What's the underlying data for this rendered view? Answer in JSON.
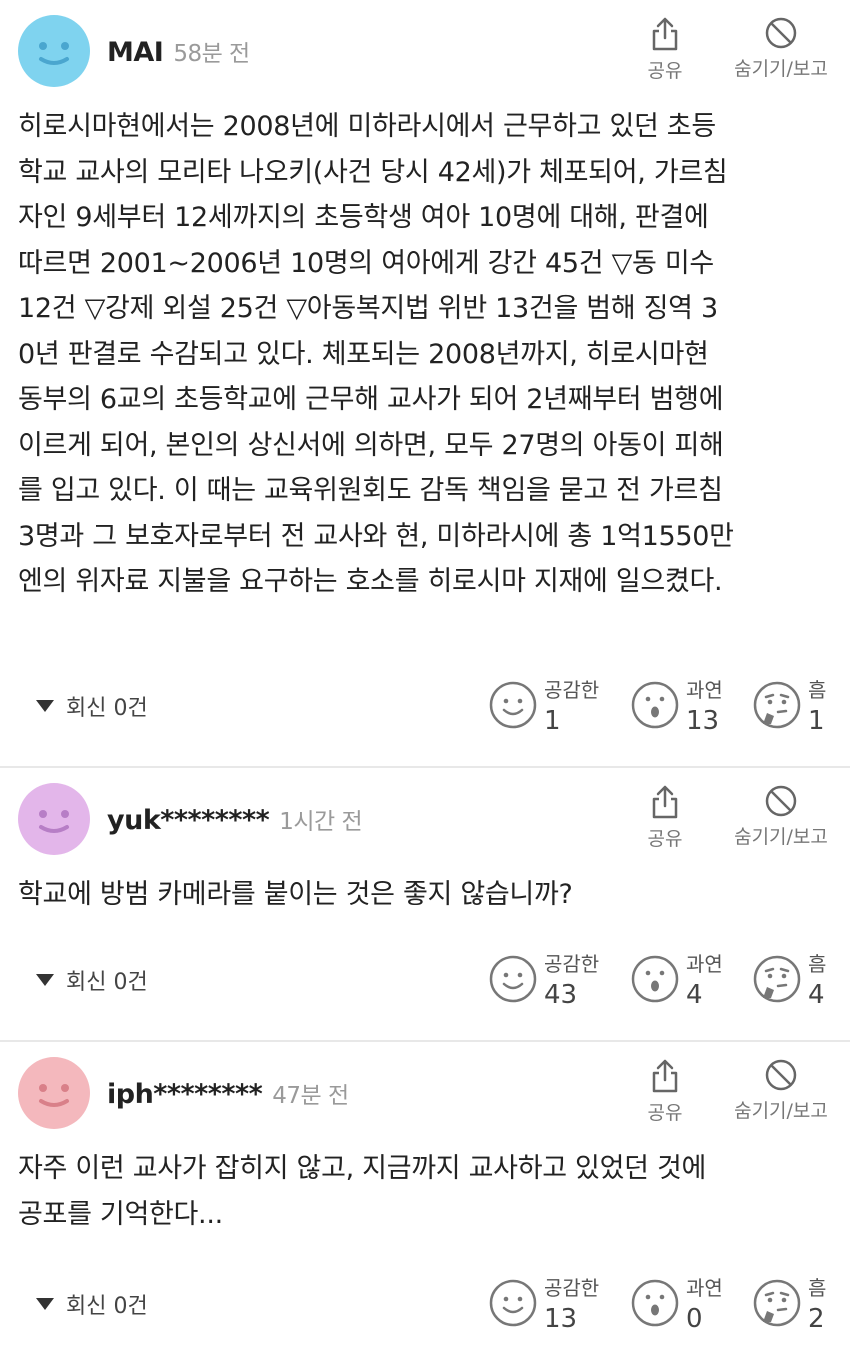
{
  "comments": [
    {
      "username": "MAI",
      "time": "58분 전",
      "avatar_color": "#7fd3ef",
      "share_label": "공유",
      "hide_label": "숨기기/보고",
      "text": "히로시마현에서는 2008년에 미하라시에서 근무하고 있던 초등\n학교 교사의 모리타 나오키(사건 당시 42세)가 체포되어, 가르침\n자인 9세부터 12세까지의 초등학생 여아 10명에 대해, 판결에\n따르면 2001~2006년 10명의 여아에게 강간 45건 ▽동 미수\n12건 ▽강제 외설 25건 ▽아동복지법 위반 13건을 범해 징역 3\n0년 판결로 수감되고 있다. 체포되는 2008년까지, 히로시마현\n동부의 6교의 초등학교에 근무해 교사가 되어 2년째부터 범행에\n이르게 되어, 본인의 상신서에 의하면, 모두 27명의 아동이 피해\n를 입고 있다. 이 때는 교육위원회도 감독 책임을 묻고 전 가르침\n3명과 그 보호자로부터 전 교사와 현, 미하라시에 총 1억1550만\n엔의 위자료 지불을 요구하는 호소를 히로시마 지재에 일으켰다.",
      "replies": "회신 0건",
      "reactions": [
        {
          "label": "공감한",
          "count": "1",
          "icon": "smile-icon"
        },
        {
          "label": "과연",
          "count": "13",
          "icon": "surprised-icon"
        },
        {
          "label": "흠",
          "count": "1",
          "icon": "thinking-icon"
        }
      ]
    },
    {
      "username": "yuk********",
      "time": "1시간 전",
      "avatar_color": "#e3b6ea",
      "share_label": "공유",
      "hide_label": "숨기기/보고",
      "text": "학교에 방범 카메라를 붙이는 것은 좋지 않습니까?",
      "replies": "회신 0건",
      "reactions": [
        {
          "label": "공감한",
          "count": "43",
          "icon": "smile-icon"
        },
        {
          "label": "과연",
          "count": "4",
          "icon": "surprised-icon"
        },
        {
          "label": "흠",
          "count": "4",
          "icon": "thinking-icon"
        }
      ]
    },
    {
      "username": "iph********",
      "time": "47분 전",
      "avatar_color": "#f4b8bd",
      "share_label": "공유",
      "hide_label": "숨기기/보고",
      "text": "자주 이런 교사가 잡히지 않고, 지금까지 교사하고 있었던 것에\n공포를 기억한다...",
      "replies": "회신 0건",
      "reactions": [
        {
          "label": "공감한",
          "count": "13",
          "icon": "smile-icon"
        },
        {
          "label": "과연",
          "count": "0",
          "icon": "surprised-icon"
        },
        {
          "label": "흠",
          "count": "2",
          "icon": "thinking-icon"
        }
      ]
    }
  ]
}
